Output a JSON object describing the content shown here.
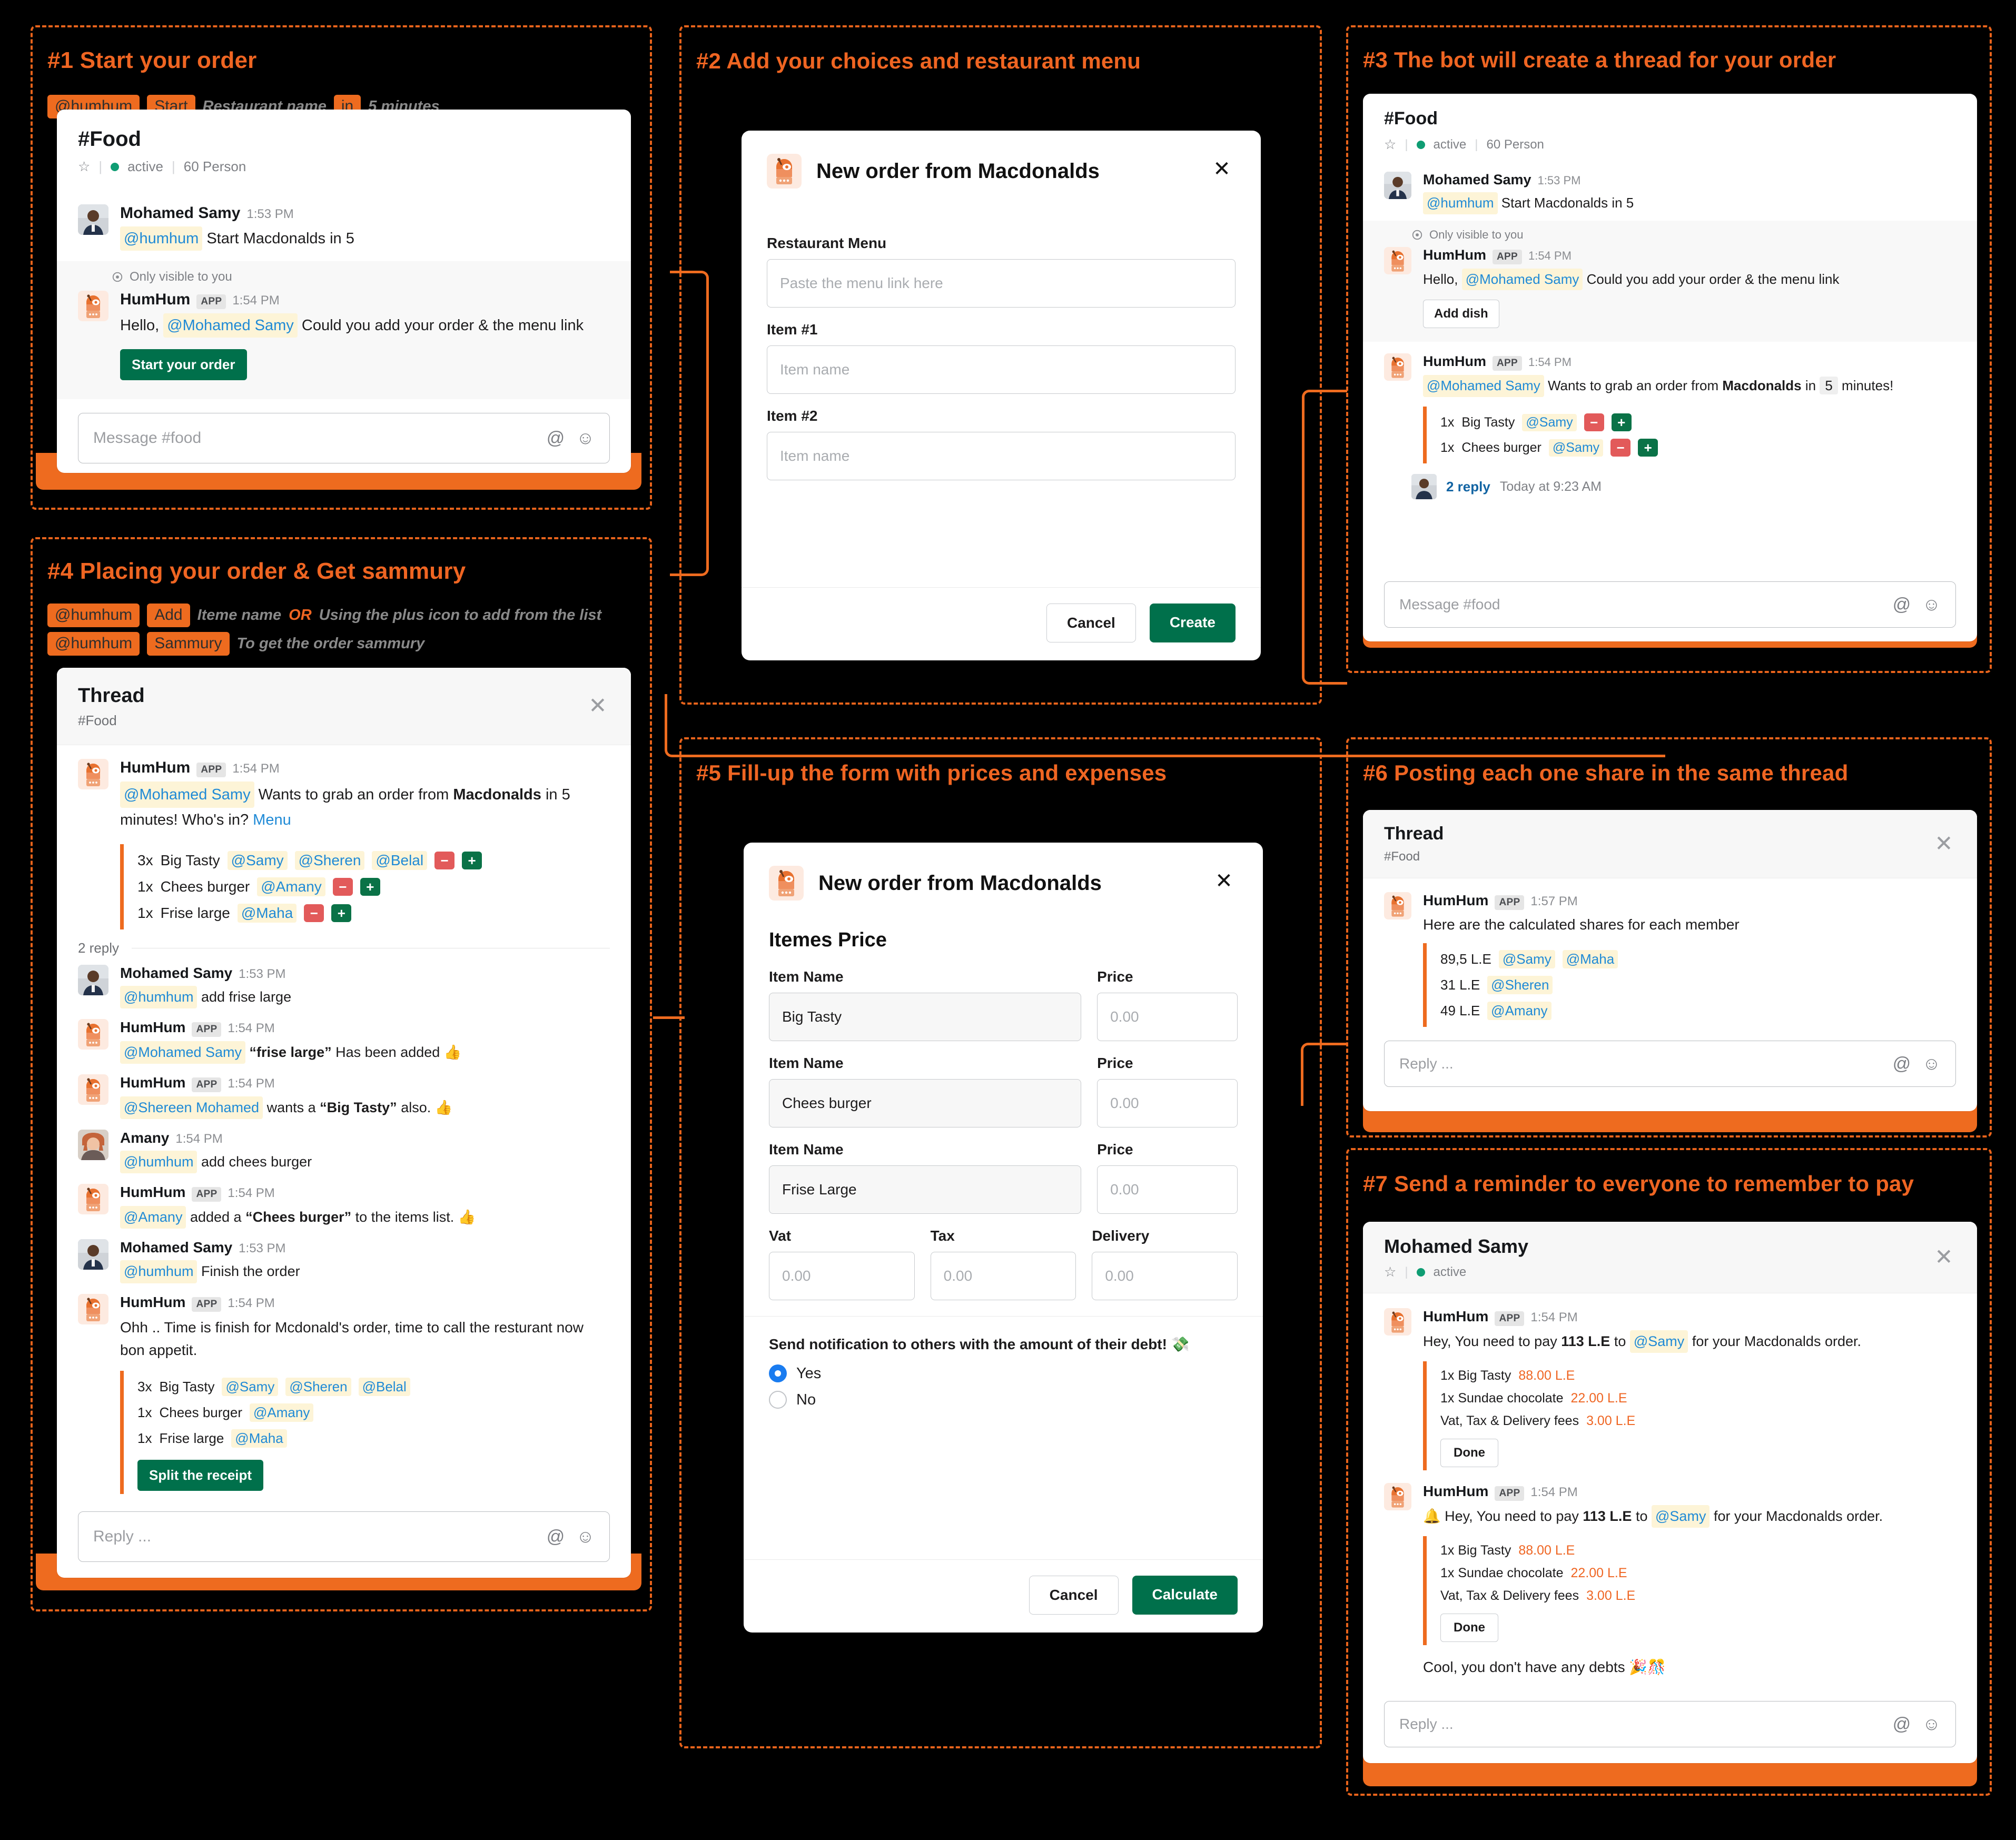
{
  "steps": [
    {
      "id": "s1",
      "title": "#1 Start your order"
    },
    {
      "id": "s2",
      "title": "#2 Add your choices and restaurant menu"
    },
    {
      "id": "s3",
      "title": "#3 The bot will create a thread for your order"
    },
    {
      "id": "s4",
      "title": "#4 Placing your order & Get sammury"
    },
    {
      "id": "s5",
      "title": "#5 Fill-up the form with prices and expenses"
    },
    {
      "id": "s6",
      "title": "#6 Posting each one share in the same thread"
    },
    {
      "id": "s7",
      "title": "#7 Send a reminder to everyone to remember to pay"
    }
  ],
  "hints": {
    "step1": {
      "mention": "@humhum",
      "command": "Start",
      "note1": "Restaurant name",
      "word_in": "in",
      "note2": "5 minutes"
    },
    "step4_line1": {
      "mention": "@humhum",
      "command": "Add",
      "note1": "Iteme name",
      "or": "OR",
      "note2": "Using the plus icon to add from the list"
    },
    "step4_line2": {
      "mention": "@humhum",
      "command": "Sammury",
      "note1": "To get the order sammury"
    }
  },
  "channel": {
    "name": "#Food",
    "status": "active",
    "members": "60 Person",
    "composer_placeholder": "Message #food"
  },
  "thread": {
    "title": "Thread",
    "subtitle": "#Food",
    "reply_placeholder": "Reply ..."
  },
  "dm": {
    "title": "Mohamed Samy",
    "status": "active",
    "reply_placeholder": "Reply ..."
  },
  "users": {
    "samy": "Mohamed Samy",
    "amany": "Amany",
    "bot": "HumHum"
  },
  "app_badge": "APP",
  "panel1": {
    "msg1": {
      "author": "Mohamed Samy",
      "time": "1:53 PM",
      "mention": "@humhum",
      "text": "Start Macdonalds in 5"
    },
    "ephemeral_label": "Only visible to you",
    "msg2": {
      "author": "HumHum",
      "time": "1:54 PM",
      "pre": "Hello,",
      "mention": "@Mohamed Samy",
      "post": "Could you add your order & the menu link",
      "button": "Start your order"
    }
  },
  "panel2": {
    "modal_title": "New order from Macdonalds",
    "fields": [
      {
        "label": "Restaurant Menu",
        "placeholder": "Paste the menu link here",
        "value": ""
      },
      {
        "label": "Item #1",
        "placeholder": "Item name",
        "value": ""
      },
      {
        "label": "Item #2",
        "placeholder": "Item name",
        "value": ""
      }
    ],
    "cancel": "Cancel",
    "submit": "Create"
  },
  "panel3": {
    "msg1": {
      "author": "Mohamed Samy",
      "time": "1:53 PM",
      "mention": "@humhum",
      "text": "Start Macdonalds in 5"
    },
    "ephemeral_label": "Only visible to you",
    "msg2": {
      "author": "HumHum",
      "time": "1:54 PM",
      "pre": "Hello,",
      "mention": "@Mohamed Samy",
      "post": "Could you add your order & the menu link",
      "button": "Add dish"
    },
    "msg3": {
      "author": "HumHum",
      "time": "1:54 PM",
      "mention": "@Mohamed Samy",
      "text_a": "Wants to grab an order from",
      "restaurant": "Macdonalds",
      "word_in": "in",
      "minutes": "5",
      "text_b": "minutes!",
      "items": [
        {
          "qty": "1x",
          "name": "Big Tasty",
          "people": [
            "@Samy"
          ]
        },
        {
          "qty": "1x",
          "name": "Chees burger",
          "people": [
            "@Samy"
          ]
        }
      ]
    },
    "replies": {
      "count": "2 reply",
      "time": "Today at 9:23 AM"
    }
  },
  "panel4": {
    "root": {
      "author": "HumHum",
      "time": "1:54 PM",
      "mention": "@Mohamed Samy",
      "text_a": "Wants to grab an order from",
      "restaurant": "Macdonalds",
      "word_in": "in",
      "minutes": "5",
      "text_b": "minutes! Who's in?",
      "menu_link": "Menu",
      "items": [
        {
          "qty": "3x",
          "name": "Big Tasty",
          "people": [
            "@Samy",
            "@Sheren",
            "@Belal"
          ]
        },
        {
          "qty": "1x",
          "name": "Chees burger",
          "people": [
            "@Amany"
          ]
        },
        {
          "qty": "1x",
          "name": "Frise large",
          "people": [
            "@Maha"
          ]
        }
      ]
    },
    "replies_label": "2 reply",
    "replies": [
      {
        "author": "Mohamed Samy",
        "time": "1:53 PM",
        "avatar": "samy",
        "mention": "@humhum",
        "text": "add frise large"
      },
      {
        "author": "HumHum",
        "time": "1:54 PM",
        "avatar": "bot",
        "mention": "@Mohamed Samy",
        "quoted": "“frise large”",
        "text": "Has been added 👍"
      },
      {
        "author": "HumHum",
        "time": "1:54 PM",
        "avatar": "bot",
        "mention": "@Shereen Mohamed",
        "pre": "wants a",
        "quoted": "“Big Tasty”",
        "text": "also. 👍"
      },
      {
        "author": "Amany",
        "time": "1:54 PM",
        "avatar": "amany",
        "mention": "@humhum",
        "text": "add chees burger"
      },
      {
        "author": "HumHum",
        "time": "1:54 PM",
        "avatar": "bot",
        "mention": "@Amany",
        "pre": "added a",
        "quoted": "“Chees burger”",
        "text": "to the items list. 👍"
      },
      {
        "author": "Mohamed Samy",
        "time": "1:53 PM",
        "avatar": "samy",
        "mention": "@humhum",
        "text": "Finish the order"
      }
    ],
    "final": {
      "author": "HumHum",
      "time": "1:54 PM",
      "text": "Ohh .. Time is finish for Mcdonald's order, time to call the resturant now bon appetit.",
      "items": [
        {
          "qty": "3x",
          "name": "Big Tasty",
          "people": [
            "@Samy",
            "@Sheren",
            "@Belal"
          ]
        },
        {
          "qty": "1x",
          "name": "Chees burger",
          "people": [
            "@Amany"
          ]
        },
        {
          "qty": "1x",
          "name": "Frise large",
          "people": [
            "@Maha"
          ]
        }
      ],
      "button": "Split the receipt"
    }
  },
  "panel5": {
    "modal_title": "New order from Macdonalds",
    "section_title": "Itemes Price",
    "item_label": "Item Name",
    "price_label": "Price",
    "price_placeholder": "0.00",
    "items": [
      {
        "name": "Big Tasty",
        "price": ""
      },
      {
        "name": "Chees burger",
        "price": ""
      },
      {
        "name": "Frise Large",
        "price": ""
      }
    ],
    "fees": [
      {
        "label": "Vat",
        "placeholder": "0.00",
        "value": ""
      },
      {
        "label": "Tax",
        "placeholder": "0.00",
        "value": ""
      },
      {
        "label": "Delivery",
        "placeholder": "0.00",
        "value": ""
      }
    ],
    "notify_question": "Send notification to others with the amount of their debt! 💸",
    "options": [
      {
        "label": "Yes",
        "selected": true
      },
      {
        "label": "No",
        "selected": false
      }
    ],
    "cancel": "Cancel",
    "submit": "Calculate"
  },
  "panel6": {
    "msg": {
      "author": "HumHum",
      "time": "1:57 PM",
      "text": "Here are the calculated shares for each member"
    },
    "shares": [
      {
        "amount": "89,5 L.E",
        "people": [
          "@Samy",
          "@Maha"
        ]
      },
      {
        "amount": "31 L.E",
        "people": [
          "@Sheren"
        ]
      },
      {
        "amount": "49 L.E",
        "people": [
          "@Amany"
        ]
      }
    ]
  },
  "panel7": {
    "msg1": {
      "author": "HumHum",
      "time": "1:54 PM",
      "pre": "Hey, You need to pay",
      "amount": "113 L.E",
      "mid": "to",
      "mention": "@Samy",
      "post": "for your Macdonalds order.",
      "lines": [
        {
          "text": "1x Big Tasty",
          "price": "88.00 L.E"
        },
        {
          "text": "1x Sundae chocolate",
          "price": "22.00 L.E"
        },
        {
          "text": "Vat, Tax & Delivery fees",
          "price": "3.00 L.E"
        }
      ],
      "button": "Done"
    },
    "msg2": {
      "author": "HumHum",
      "time": "1:54 PM",
      "emoji": "🔔",
      "pre": "Hey, You need to pay",
      "amount": "113 L.E",
      "mid": "to",
      "mention": "@Samy",
      "post": "for your Macdonalds order.",
      "lines": [
        {
          "text": "1x Big Tasty",
          "price": "88.00 L.E"
        },
        {
          "text": "1x Sundae chocolate",
          "price": "22.00 L.E"
        },
        {
          "text": "Vat, Tax & Delivery fees",
          "price": "3.00 L.E"
        }
      ],
      "button": "Done",
      "footer": "Cool, you don't have any debts 🎉🎊"
    }
  },
  "colors": {
    "accent_orange": "#ee6b1f",
    "title_orange": "#ef6522",
    "green_button": "#00704b",
    "minus_red": "#e25a5a",
    "plus_green": "#0a7247",
    "mention_bg": "#fdf4d7",
    "mention_text": "#1f8ad6",
    "price_orange": "#ef6522",
    "radio_blue": "#1a7cf0"
  }
}
